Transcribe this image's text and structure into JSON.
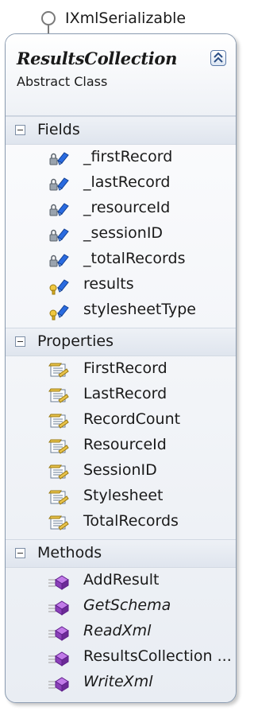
{
  "interface": {
    "name": "IXmlSerializable"
  },
  "class": {
    "name": "ResultsCollection",
    "kind": "Abstract Class"
  },
  "sections": {
    "fields": {
      "label": "Fields",
      "items": [
        {
          "name": "_firstRecord",
          "icon": "private-field-icon"
        },
        {
          "name": "_lastRecord",
          "icon": "private-field-icon"
        },
        {
          "name": "_resourceId",
          "icon": "private-field-icon"
        },
        {
          "name": "_sessionID",
          "icon": "private-field-icon"
        },
        {
          "name": "_totalRecords",
          "icon": "private-field-icon"
        },
        {
          "name": "results",
          "icon": "protected-field-icon"
        },
        {
          "name": "stylesheetType",
          "icon": "protected-field-icon"
        }
      ]
    },
    "properties": {
      "label": "Properties",
      "items": [
        {
          "name": "FirstRecord",
          "icon": "property-icon"
        },
        {
          "name": "LastRecord",
          "icon": "property-icon"
        },
        {
          "name": "RecordCount",
          "icon": "property-icon"
        },
        {
          "name": "ResourceId",
          "icon": "property-icon"
        },
        {
          "name": "SessionID",
          "icon": "property-icon"
        },
        {
          "name": "Stylesheet",
          "icon": "property-icon"
        },
        {
          "name": "TotalRecords",
          "icon": "property-icon"
        }
      ]
    },
    "methods": {
      "label": "Methods",
      "items": [
        {
          "name": "AddResult",
          "icon": "method-icon",
          "italic": false
        },
        {
          "name": "GetSchema",
          "icon": "method-icon",
          "italic": true
        },
        {
          "name": "ReadXml",
          "icon": "method-icon",
          "italic": true
        },
        {
          "name": "ResultsCollection ...",
          "icon": "method-icon",
          "italic": false
        },
        {
          "name": "WriteXml",
          "icon": "method-icon",
          "italic": true
        }
      ]
    }
  },
  "colors": {
    "border": "#8a9bb0",
    "section_bg": "#dfe5ee",
    "method_purple": "#8a3fb8",
    "field_blue": "#1e5bd6",
    "property_yellow": "#e8c24a"
  }
}
